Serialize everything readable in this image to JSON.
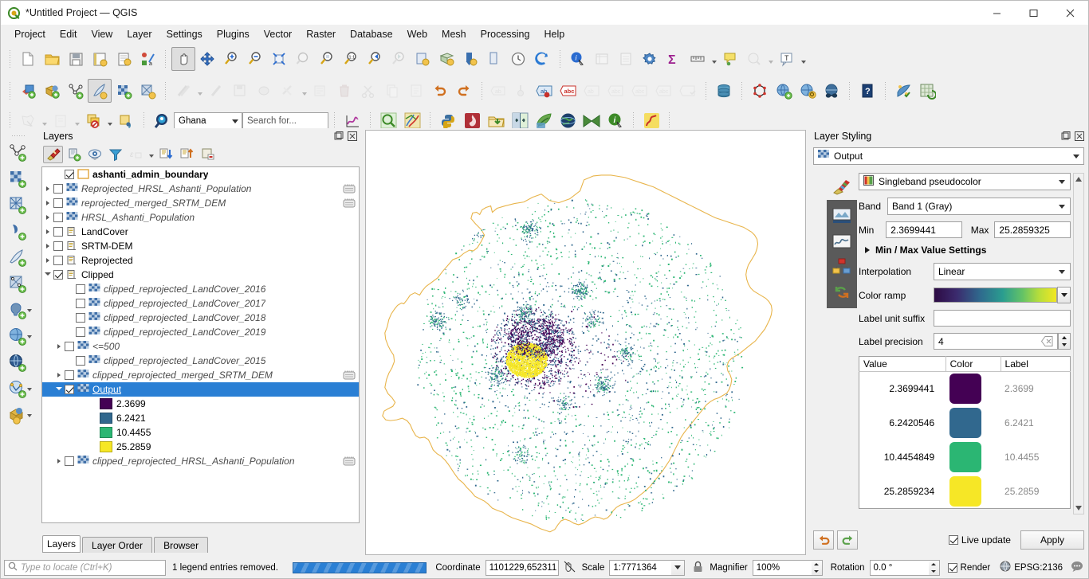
{
  "window": {
    "title": "*Untitled Project — QGIS",
    "logo_icon": "qgis-logo-icon",
    "minimize_label": "─",
    "maximize_label": "☐",
    "close_label": "✕"
  },
  "menubar": [
    {
      "label": "Project"
    },
    {
      "label": "Edit"
    },
    {
      "label": "View"
    },
    {
      "label": "Layer"
    },
    {
      "label": "Settings"
    },
    {
      "label": "Plugins"
    },
    {
      "label": "Vector"
    },
    {
      "label": "Raster"
    },
    {
      "label": "Database"
    },
    {
      "label": "Web"
    },
    {
      "label": "Mesh"
    },
    {
      "label": "Processing"
    },
    {
      "label": "Help"
    }
  ],
  "toolbar_row1": [
    "new-project-icon",
    "open-project-icon",
    "save-project-icon",
    "save-project-as-icon",
    "new-print-layout-icon",
    "style-manager-icon",
    "pan-map-icon",
    "pan-to-selection-icon",
    "zoom-in-icon",
    "zoom-out-icon",
    "zoom-full-icon",
    "zoom-to-selection-icon",
    "zoom-to-layer-icon",
    "zoom-native-icon",
    "zoom-last-icon",
    "zoom-next-icon",
    "new-map-view-icon",
    "new-3d-map-view-icon",
    "refresh-icon",
    "draw-icon",
    "temporal-controller-icon",
    "refresh-map-icon",
    "identify-features-icon",
    "open-attribute-table-icon",
    "field-calculator-icon",
    "options-icon",
    "statistical-summary-icon",
    "measure-line-icon",
    "map-tips-icon",
    "show-spatial-bookmarks-icon",
    "text-annotation-icon"
  ],
  "toolbar_row2": [
    "add-layer-icon",
    "add-wms-layer-icon",
    "add-vector-layer-icon",
    "current-edits-icon",
    "add-raster-layer-icon",
    "add-mesh-layer-icon",
    "digitize-line-icon",
    "digitize-point-icon",
    "save-layer-edits-icon",
    "vertex-tool-icon",
    "modify-attributes-icon",
    "multi-edit-icon",
    "delete-selected-icon",
    "cut-features-icon",
    "copy-features-icon",
    "paste-features-icon",
    "undo-icon",
    "redo-icon",
    "label-icon",
    "pin-labels-icon",
    "highlight-labels-icon",
    "show-hide-labels-icon",
    "move-label-icon",
    "rotate-label-icon",
    "change-label-icon",
    "db-manager-icon",
    "node-tool-icon",
    "add-web-layer-icon",
    "metasearch-icon",
    "qgis-browser-icon",
    "help-icon",
    "plugin-manager-icon",
    "processing-toolbox-icon"
  ],
  "toolbar_row3": {
    "icons_left": [
      "select-features-icon",
      "deselect-features-icon",
      "select-by-location-icon",
      "select-by-value-icon",
      "locate-icon"
    ],
    "combo_value": "Ghana",
    "search_placeholder": "Search for...",
    "icons_right": [
      "plot-icon",
      "zoom-to-feature-icon",
      "map-themes-icon",
      "python-console-icon",
      "qgis-resource-sharing-icon",
      "data-plotly-icon",
      "swipe-tool-icon",
      "leaflet-export-icon",
      "globe-plugin-icon",
      "mmqgis-icon",
      "info-plugin-icon",
      "profile-tool-icon"
    ]
  },
  "vertical_toolbar": [
    "new-shapefile-layer-icon",
    "new-geopackage-layer-icon",
    "new-spatialite-layer-icon",
    "new-virtual-layer-icon",
    "new-memory-layer-icon",
    "new-mesh-layer-icon",
    "add-postgis-layer-icon",
    "add-wms-wmts-layer-icon",
    "add-wcs-layer-icon",
    "add-wfs-layer-icon",
    "add-vector-tile-layer-icon"
  ],
  "layers_panel": {
    "title": "Layers",
    "float_icon": "undock-icon",
    "close_icon": "close-icon",
    "toolbar": [
      {
        "name": "open-layer-styling-panel",
        "active": true
      },
      {
        "name": "add-group",
        "active": false
      },
      {
        "name": "manage-map-themes",
        "active": false
      },
      {
        "name": "filter-legend-by-map-content",
        "active": false
      },
      {
        "name": "filter-legend-by-expression",
        "active": false,
        "disabled": true
      },
      {
        "name": "expand-all",
        "active": false
      },
      {
        "name": "collapse-all",
        "active": false
      },
      {
        "name": "remove-layer-or-group",
        "active": false
      }
    ],
    "tabs": [
      {
        "label": "Layers",
        "selected": true
      },
      {
        "label": "Layer Order",
        "selected": false
      },
      {
        "label": "Browser",
        "selected": false
      }
    ],
    "tree": [
      {
        "label": "ashanti_admin_boundary",
        "indent": 1,
        "expander": "none",
        "checkbox": "checked",
        "icon": "polygon-outline-icon",
        "style": "bold",
        "edit_badge": false
      },
      {
        "label": "Reprojected_HRSL_Ashanti_Population",
        "indent": 0,
        "expander": "closed",
        "checkbox": "unchecked",
        "icon": "raster-icon",
        "style": "italic",
        "edit_badge": true
      },
      {
        "label": "reprojected_merged_SRTM_DEM",
        "indent": 0,
        "expander": "closed",
        "checkbox": "unchecked",
        "icon": "raster-icon",
        "style": "italic",
        "edit_badge": true
      },
      {
        "label": "HRSL_Ashanti_Population",
        "indent": 0,
        "expander": "closed",
        "checkbox": "unchecked",
        "icon": "raster-icon",
        "style": "italic",
        "edit_badge": false
      },
      {
        "label": "LandCover",
        "indent": 0,
        "expander": "closed",
        "checkbox": "unchecked",
        "icon": "group-icon",
        "style": "normal",
        "edit_badge": false
      },
      {
        "label": "SRTM-DEM",
        "indent": 0,
        "expander": "closed",
        "checkbox": "unchecked",
        "icon": "group-icon",
        "style": "normal",
        "edit_badge": false
      },
      {
        "label": "Reprojected",
        "indent": 0,
        "expander": "closed",
        "checkbox": "unchecked",
        "icon": "group-icon",
        "style": "normal",
        "edit_badge": false
      },
      {
        "label": "Clipped",
        "indent": 0,
        "expander": "open",
        "checkbox": "checked",
        "icon": "group-icon",
        "style": "normal",
        "edit_badge": false
      },
      {
        "label": "clipped_reprojected_LandCover_2016",
        "indent": 2,
        "expander": "none",
        "checkbox": "unchecked",
        "icon": "raster-icon",
        "style": "italic",
        "edit_badge": false
      },
      {
        "label": "clipped_reprojected_LandCover_2017",
        "indent": 2,
        "expander": "none",
        "checkbox": "unchecked",
        "icon": "raster-icon",
        "style": "italic",
        "edit_badge": false
      },
      {
        "label": "clipped_reprojected_LandCover_2018",
        "indent": 2,
        "expander": "none",
        "checkbox": "unchecked",
        "icon": "raster-icon",
        "style": "italic",
        "edit_badge": false
      },
      {
        "label": "clipped_reprojected_LandCover_2019",
        "indent": 2,
        "expander": "none",
        "checkbox": "unchecked",
        "icon": "raster-icon",
        "style": "italic",
        "edit_badge": false
      },
      {
        "label": "<=500",
        "indent": 1,
        "expander": "closed",
        "checkbox": "unchecked",
        "icon": "raster-icon",
        "style": "italic",
        "edit_badge": false
      },
      {
        "label": "clipped_reprojected_LandCover_2015",
        "indent": 2,
        "expander": "none",
        "checkbox": "unchecked",
        "icon": "raster-icon",
        "style": "italic",
        "edit_badge": false
      },
      {
        "label": "clipped_reprojected_merged_SRTM_DEM",
        "indent": 1,
        "expander": "closed",
        "checkbox": "unchecked",
        "icon": "raster-icon",
        "style": "italic",
        "edit_badge": true
      },
      {
        "label": "Output",
        "indent": 1,
        "expander": "open",
        "checkbox": "checked",
        "icon": "raster-icon",
        "style": "selected",
        "edit_badge": false
      },
      {
        "label": "2.3699",
        "indent": 3,
        "expander": "none",
        "checkbox": "none",
        "icon": "swatch",
        "swatch_color": "#440154",
        "style": "normal",
        "edit_badge": false
      },
      {
        "label": "6.2421",
        "indent": 3,
        "expander": "none",
        "checkbox": "none",
        "icon": "swatch",
        "swatch_color": "#31688e",
        "style": "normal",
        "edit_badge": false
      },
      {
        "label": "10.4455",
        "indent": 3,
        "expander": "none",
        "checkbox": "none",
        "icon": "swatch",
        "swatch_color": "#2bb673",
        "style": "normal",
        "edit_badge": false
      },
      {
        "label": "25.2859",
        "indent": 3,
        "expander": "none",
        "checkbox": "none",
        "icon": "swatch",
        "swatch_color": "#f6e726",
        "style": "normal",
        "edit_badge": false
      },
      {
        "label": "clipped_reprojected_HRSL_Ashanti_Population",
        "indent": 1,
        "expander": "closed",
        "checkbox": "unchecked",
        "icon": "raster-icon",
        "style": "italic",
        "edit_badge": true
      }
    ]
  },
  "layer_styling": {
    "title": "Layer Styling",
    "float_icon": "undock-icon",
    "close_icon": "close-icon",
    "layer_name": "Output",
    "layer_icon": "raster-icon",
    "side_icons": [
      "symbology-icon",
      "transparency-icon",
      "histogram-icon",
      "rendering-icon",
      "undo-redo-icon"
    ],
    "renderer": "Singleband pseudocolor",
    "band_label": "Band",
    "band_value": "Band 1 (Gray)",
    "min_label": "Min",
    "min_value": "2.3699441",
    "max_label": "Max",
    "max_value": "25.2859325",
    "minmax_settings_label": "Min / Max Value Settings",
    "interpolation_label": "Interpolation",
    "interpolation_value": "Linear",
    "color_ramp_label": "Color ramp",
    "color_ramp_name": "viridis",
    "label_unit_suffix_label": "Label unit suffix",
    "label_unit_suffix_value": "",
    "label_precision_label": "Label precision",
    "label_precision_value": "4",
    "table_headers": [
      "Value",
      "Color",
      "Label"
    ],
    "table_rows": [
      {
        "value": "2.3699441",
        "color": "#440154",
        "label": "2.3699"
      },
      {
        "value": "6.2420546",
        "color": "#31688e",
        "label": "6.2421"
      },
      {
        "value": "10.4454849",
        "color": "#2bb673",
        "label": "10.4455"
      },
      {
        "value": "25.2859234",
        "color": "#f6e726",
        "label": "25.2859"
      }
    ],
    "undo_icon": "undo-icon",
    "redo_icon": "redo-icon",
    "live_update_label": "Live update",
    "live_update_checked": true,
    "apply_label": "Apply"
  },
  "map": {
    "boundary_color": "#e8b44a",
    "background": "#ffffff"
  },
  "statusbar": {
    "locate_placeholder": "Type to locate (Ctrl+K)",
    "locate_icon": "search-icon",
    "message": "1 legend entries removed.",
    "progress_percent": 100,
    "coordinate_label": "Coordinate",
    "coordinate_value": "1101229,652311",
    "lock_coordinate_icon": "toggle-extents-icon",
    "scale_label": "Scale",
    "scale_value": "1:7771364",
    "lock_scale_icon": "lock-icon",
    "magnifier_label": "Magnifier",
    "magnifier_value": "100%",
    "rotation_label": "Rotation",
    "rotation_value": "0.0 °",
    "render_label": "Render",
    "render_checked": true,
    "crs_label": "EPSG:2136",
    "crs_icon": "globe-icon",
    "messages_icon": "message-log-icon"
  },
  "colors": {
    "accent_blue": "#2a7fd4",
    "panel_bg": "#f0f0f0",
    "selection": "#2a7fd4"
  }
}
